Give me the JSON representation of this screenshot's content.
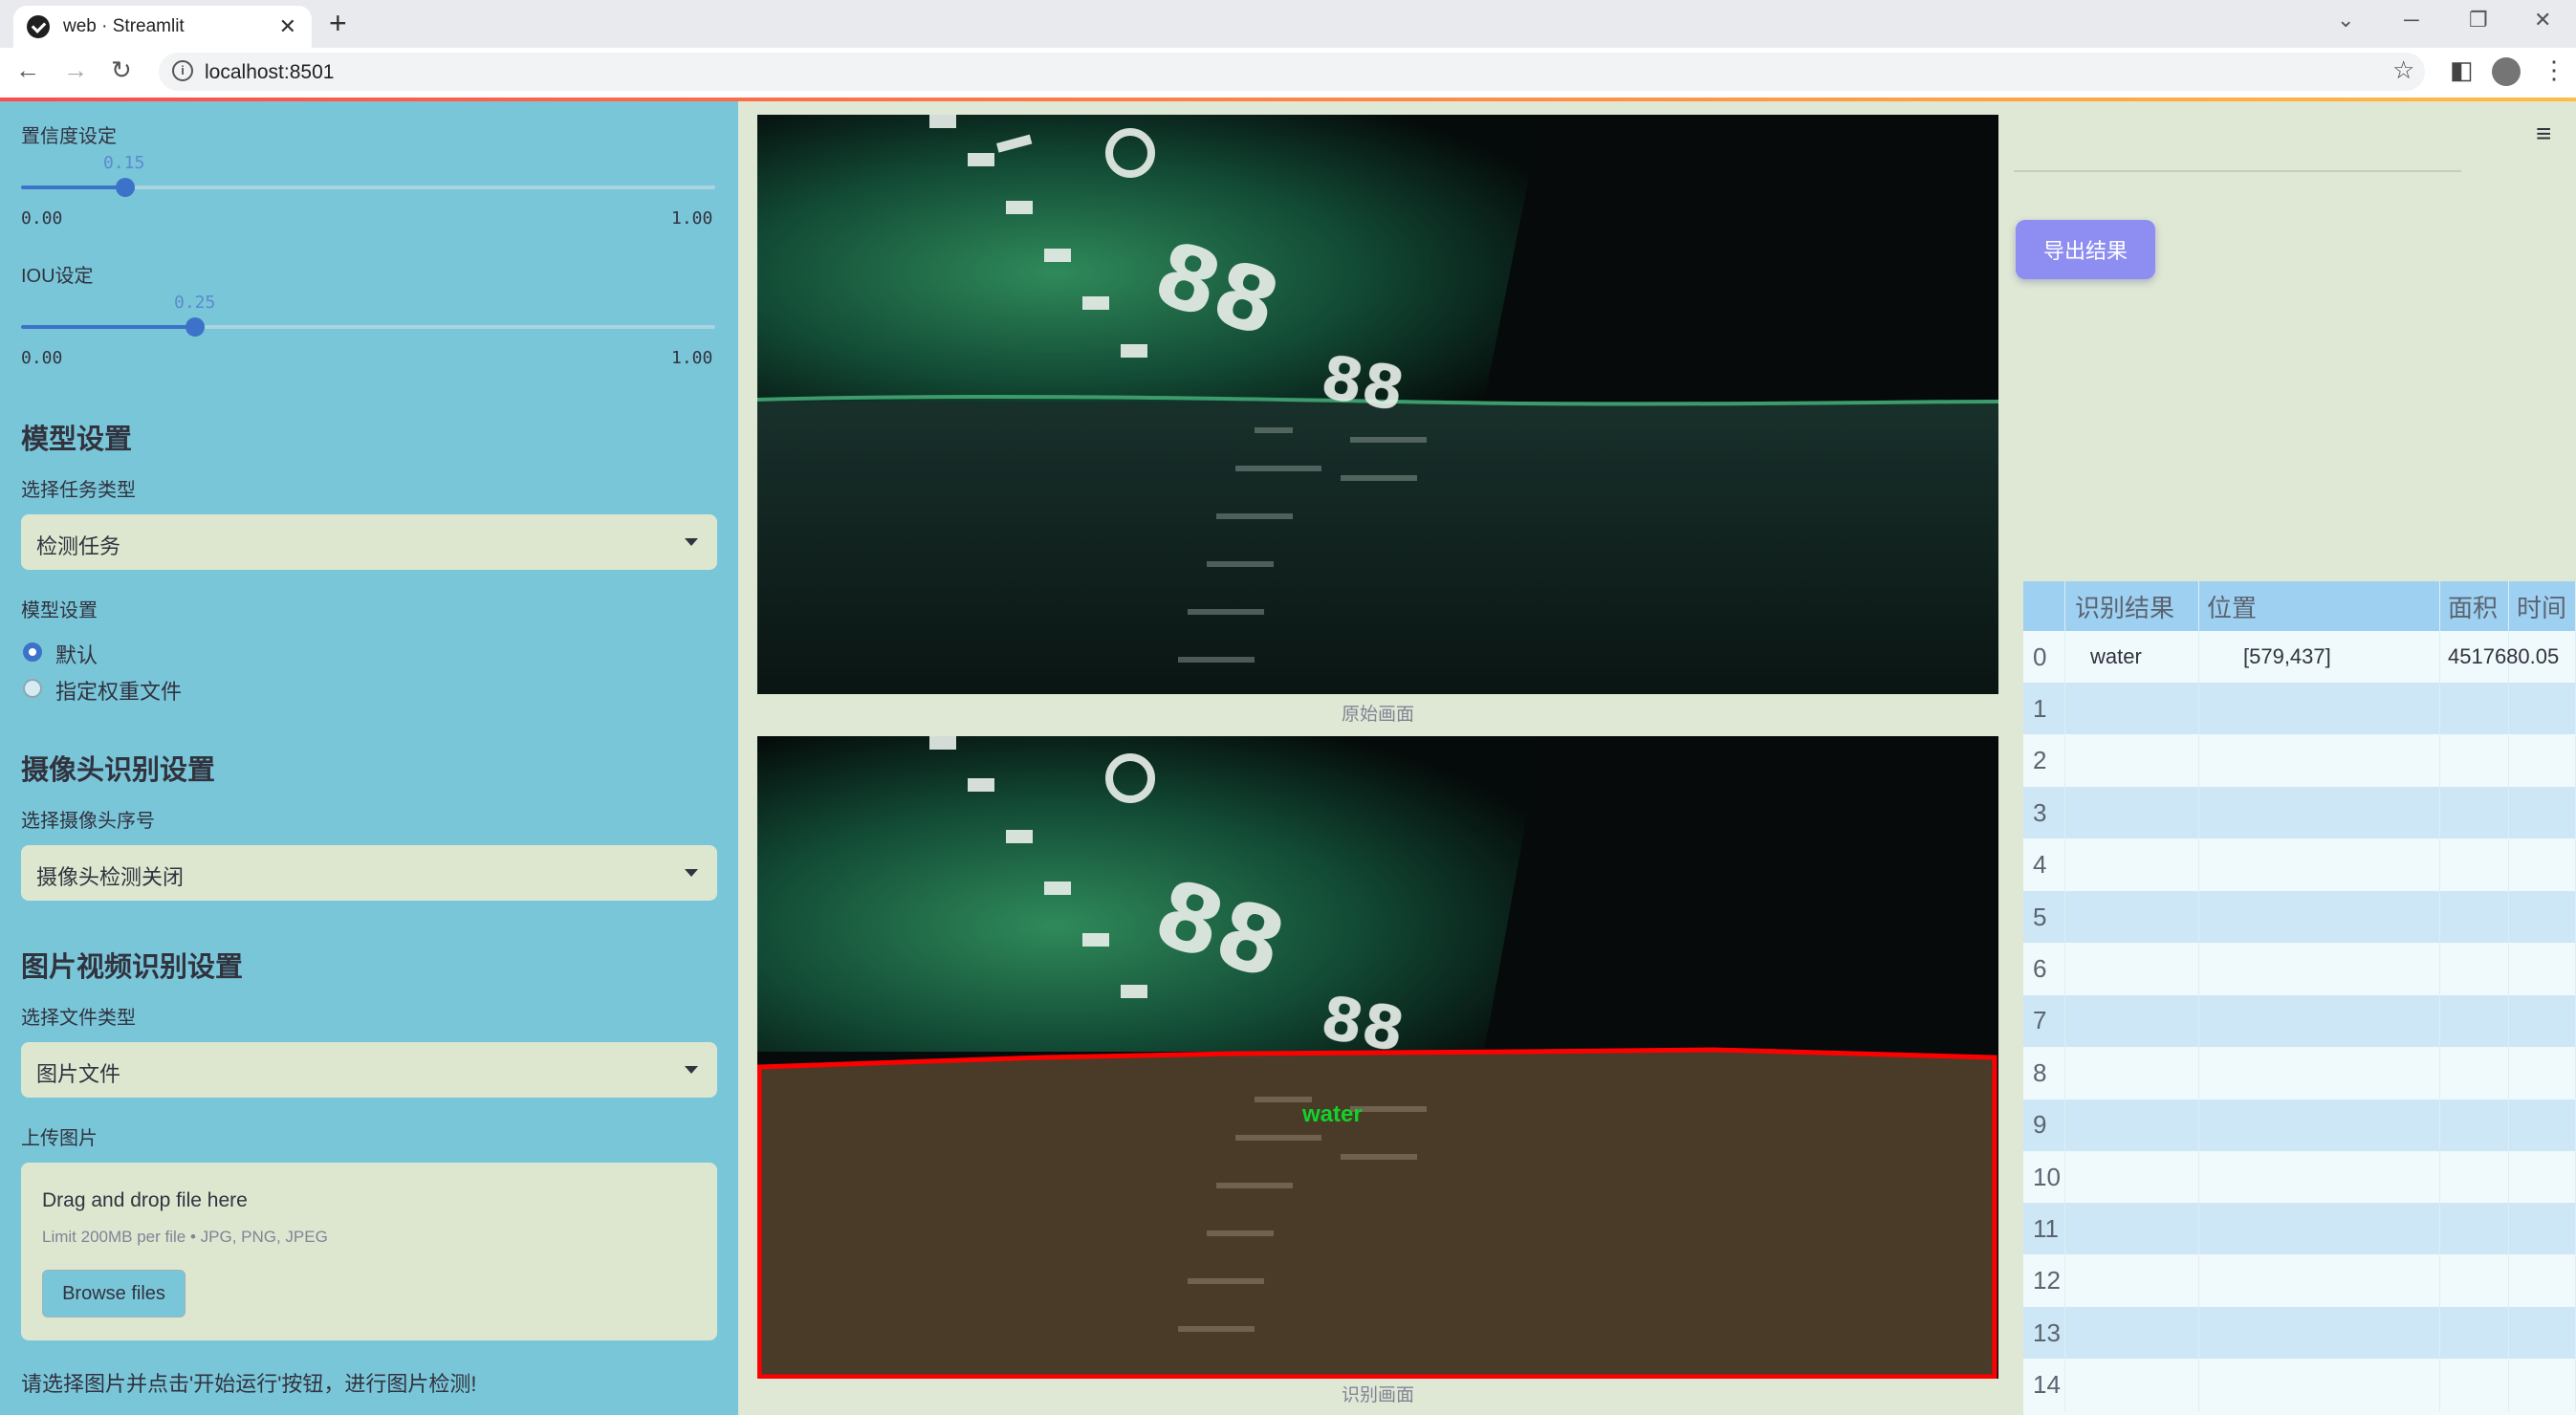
{
  "browser": {
    "tab_title": "web · Streamlit",
    "url": "localhost:8501"
  },
  "sidebar": {
    "confidence": {
      "label": "置信度设定",
      "value": "0.15",
      "min": "0.00",
      "max": "1.00",
      "fraction": 0.15
    },
    "iou": {
      "label": "IOU设定",
      "value": "0.25",
      "min": "0.00",
      "max": "1.00",
      "fraction": 0.25
    },
    "model_section": {
      "title": "模型设置",
      "task_label": "选择任务类型",
      "task_value": "检测任务",
      "model_label": "模型设置",
      "options": [
        "默认",
        "指定权重文件"
      ],
      "selected_index": 0
    },
    "camera_section": {
      "title": "摄像头识别设置",
      "camera_label": "选择摄像头序号",
      "camera_value": "摄像头检测关闭"
    },
    "media_section": {
      "title": "图片视频识别设置",
      "file_type_label": "选择文件类型",
      "file_type_value": "图片文件",
      "upload_label": "上传图片",
      "drop_title": "Drag and drop file here",
      "drop_limit": "Limit 200MB per file • JPG, PNG, JPEG",
      "browse_label": "Browse files"
    },
    "hint": "请选择图片并点击'开始运行'按钮，进行图片检测!"
  },
  "main": {
    "caption_original": "原始画面",
    "caption_detected": "识别画面",
    "detection_label": "water",
    "export_label": "导出结果",
    "colors": {
      "box": "#ff0000",
      "label": "#12d12a",
      "accent": "#8e8ef2"
    }
  },
  "table": {
    "headers": [
      "",
      "识别结果",
      "位置",
      "面积",
      "时间"
    ],
    "rows": [
      {
        "idx": "0",
        "result": "water",
        "pos": "[579,437]",
        "area": "4517680.05",
        "time": ""
      },
      {
        "idx": "1"
      },
      {
        "idx": "2"
      },
      {
        "idx": "3"
      },
      {
        "idx": "4"
      },
      {
        "idx": "5"
      },
      {
        "idx": "6"
      },
      {
        "idx": "7"
      },
      {
        "idx": "8"
      },
      {
        "idx": "9"
      },
      {
        "idx": "10"
      },
      {
        "idx": "11"
      },
      {
        "idx": "12"
      },
      {
        "idx": "13"
      },
      {
        "idx": "14"
      }
    ]
  }
}
